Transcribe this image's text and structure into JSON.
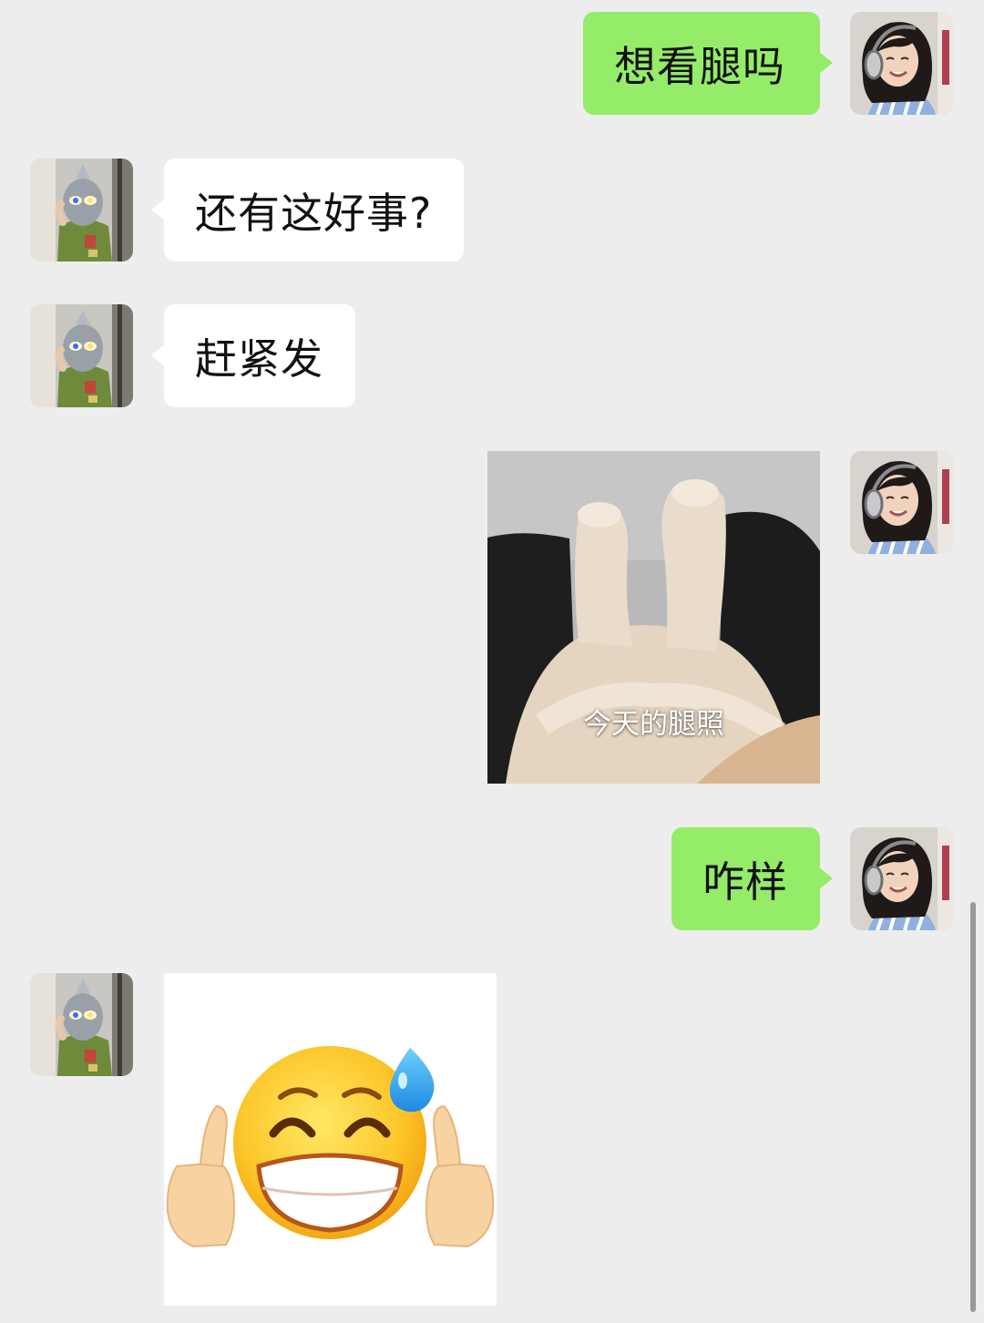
{
  "chat": {
    "messages": [
      {
        "sender": "me",
        "kind": "text",
        "text": "想看腿吗"
      },
      {
        "sender": "friend",
        "kind": "text",
        "text": "还有这好事?"
      },
      {
        "sender": "friend",
        "kind": "text",
        "text": "赶紧发"
      },
      {
        "sender": "me",
        "kind": "sticker",
        "icon": "cat-legs-sticker",
        "caption": "今天的腿照"
      },
      {
        "sender": "me",
        "kind": "text",
        "text": "咋样"
      },
      {
        "sender": "friend",
        "kind": "sticker",
        "icon": "sweat-smile-thumbs-up-emoji-sticker"
      }
    ]
  },
  "colors": {
    "background": "#ededed",
    "sent_bubble": "#95ec69",
    "received_bubble": "#ffffff"
  }
}
